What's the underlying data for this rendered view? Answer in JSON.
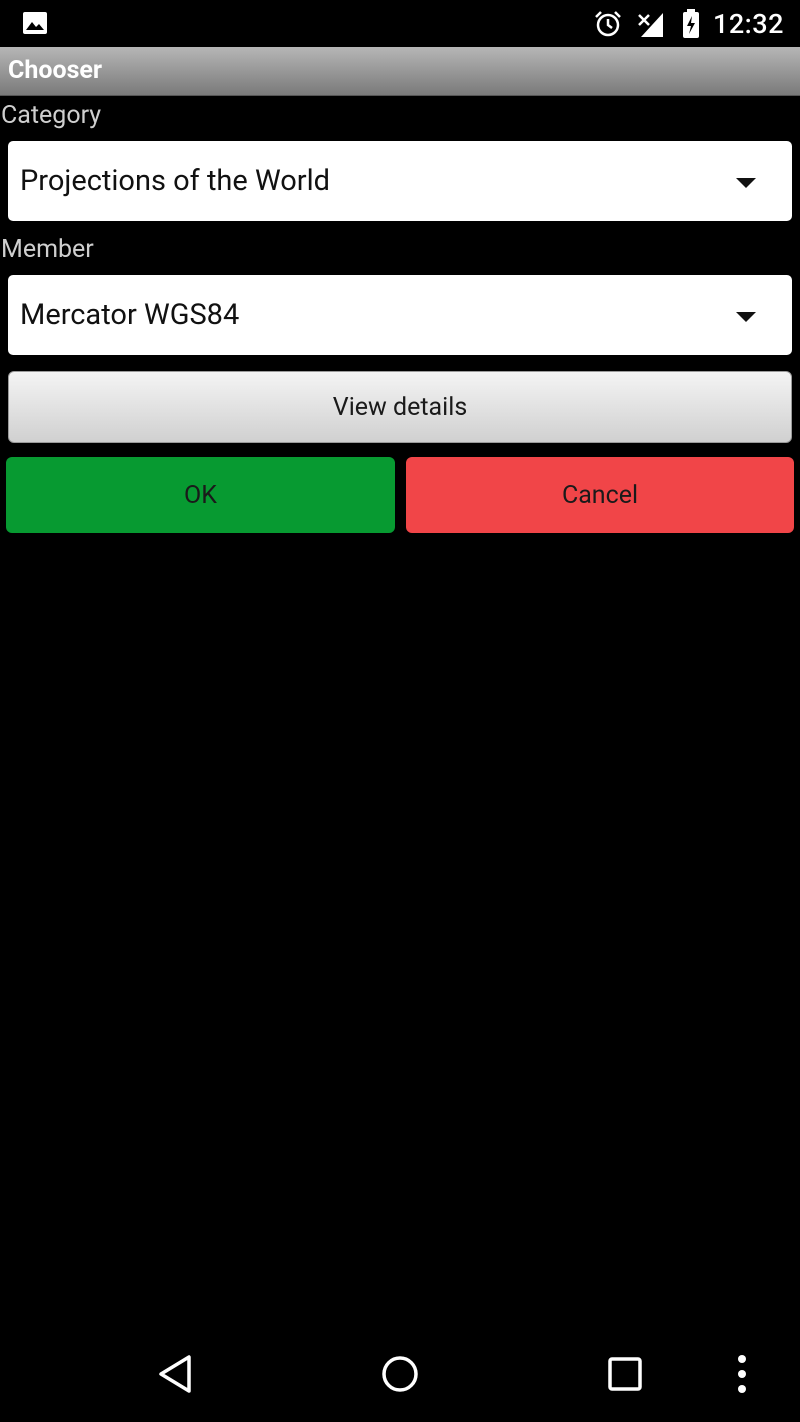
{
  "status_bar": {
    "time": "12:32",
    "icons": [
      "image-notification-icon",
      "alarm-icon",
      "signal-icon",
      "battery-charging-icon"
    ]
  },
  "title_bar": {
    "title": "Chooser"
  },
  "form": {
    "category_label": "Category",
    "category_value": "Projections of the World",
    "member_label": "Member",
    "member_value": "Mercator WGS84"
  },
  "buttons": {
    "view_details": "View details",
    "ok": "OK",
    "cancel": "Cancel"
  },
  "nav_bar": {
    "icons": [
      "back-icon",
      "home-icon",
      "recents-icon",
      "more-icon"
    ]
  },
  "colors": {
    "ok_button": "#079a31",
    "cancel_button": "#f14548",
    "background": "#000000"
  }
}
